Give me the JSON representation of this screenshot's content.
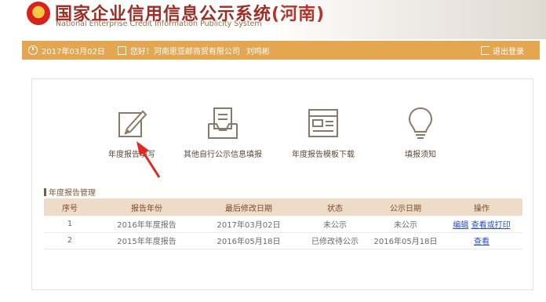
{
  "header": {
    "title_main": "国家企业信用信息公示系统",
    "title_region": "(河南)",
    "subtitle": "National Enterprise Credit Information Publicity System"
  },
  "topbar": {
    "date": "2017年03月02日",
    "greeting": "您好！河南思亚邮商贸有限公司",
    "user": "刘鸣彬",
    "logout": "退出登录"
  },
  "tools": [
    {
      "label": "年度报告填写",
      "icon": "edit-icon"
    },
    {
      "label": "其他自行公示信息填报",
      "icon": "document-icon"
    },
    {
      "label": "年度报告模板下载",
      "icon": "template-icon"
    },
    {
      "label": "填报须知",
      "icon": "lightbulb-icon"
    }
  ],
  "section": {
    "title": "年度报告管理"
  },
  "table": {
    "headers": [
      "序号",
      "报告年份",
      "最后修改日期",
      "状态",
      "公示日期",
      "操作"
    ],
    "rows": [
      {
        "no": "1",
        "year": "2016年年度报告",
        "modified": "2017年03月02日",
        "status": "未公示",
        "pubdate": "未公示",
        "action1": "编辑",
        "action2": "查看或打印"
      },
      {
        "no": "2",
        "year": "2015年年度报告",
        "modified": "2016年05月18日",
        "status": "已修改待公示",
        "pubdate": "2016年05月18日",
        "action1": "查看",
        "action2": ""
      }
    ]
  },
  "colors": {
    "brand": "#9d2d25",
    "bar": "#e4a651",
    "table_header": "#eedcc8",
    "link": "#2c4fc4",
    "arrow": "#e0281e"
  }
}
